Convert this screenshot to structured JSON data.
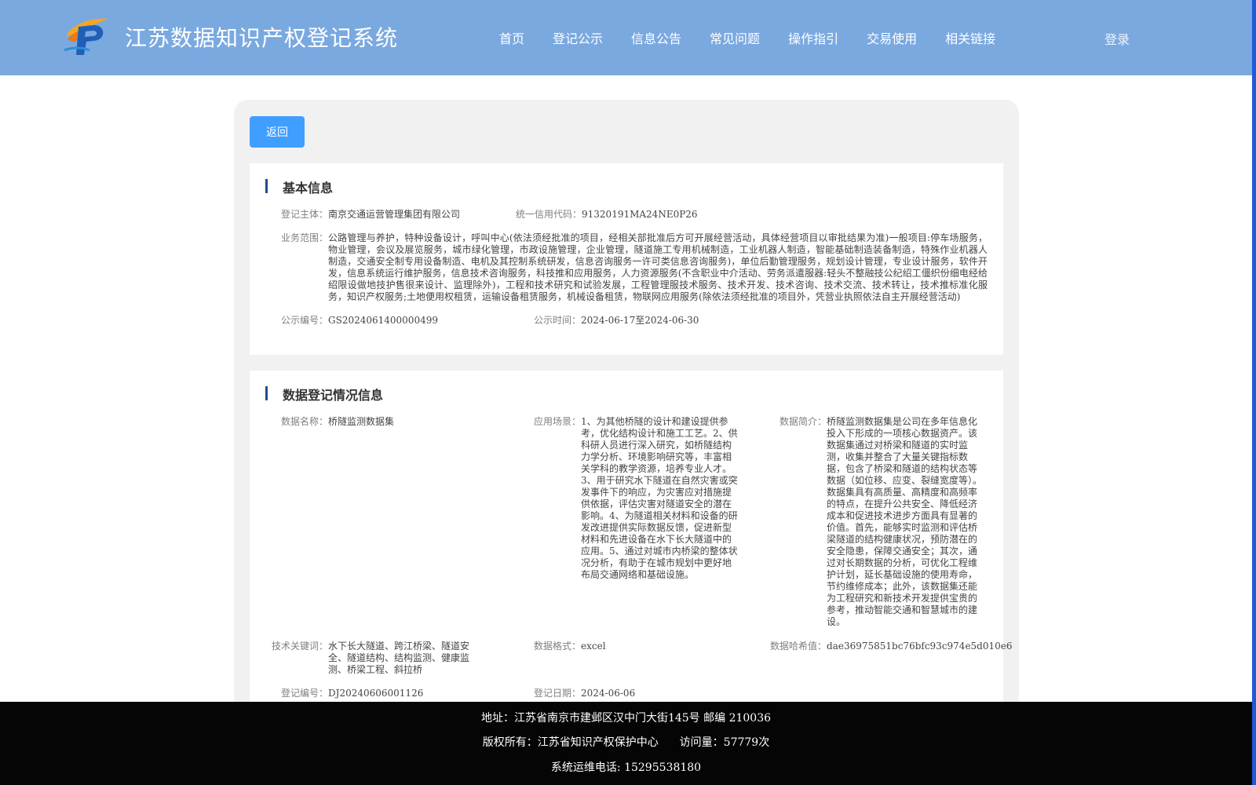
{
  "header": {
    "title": "江苏数据知识产权登记系统",
    "logo_icon": "ip-logo-icon",
    "nav": [
      "首页",
      "登记公示",
      "信息公告",
      "常见问题",
      "操作指引",
      "交易使用",
      "相关链接"
    ],
    "login": "登录"
  },
  "actions": {
    "back_label": "返回"
  },
  "basic": {
    "title": "基本信息",
    "subject_label": "登记主体：",
    "subject": "南京交通运营管理集团有限公司",
    "credit_label": "统一信用代码：",
    "credit": "91320191MA24NE0P26",
    "scope_label": "业务范围：",
    "scope": "公路管理与养护，特种设备设计，呼叫中心(依法须经批准的项目，经相关部批准后方可开展经营活动，具体经营项目以审批结果为准)一般项目:停车场服务，物业管理，会议及展览服务，城市绿化管理，市政设施管理，企业管理，隧道施工专用机械制造，工业机器人制造，智能基础制造装备制造，特殊作业机器人制造，交通安全制专用设备制造、电机及其控制系统研发，信息咨询服务一许可类信息咨询服务)，单位后勤管理服务，规划设计管理，专业设计服务，软件开发，信息系统运行维护服务，信息技术咨询服务，科技推和应用服务，人力资源服务(不含职业中介活动、劳务派遣服器:轻头不整融技公纪绍工僵织份细电经给绍限设做地技护售很来设计、监理除外)，工程和技术研究和试验发展，工程管理服技术服务、技术开发、技术咨询、技术交流、技术转让，技术推标准化服务，知识产权服务;土地便用权租赁，运输设备租赁服务，机械设备租赁，物联网应用服务(除依法须经批准的项目外，凭营业执照依法自主开展经营活动)",
    "notice_no_label": "公示编号：",
    "notice_no": "GS2024061400000499",
    "notice_time_label": "公示时间：",
    "notice_time_start": "2024-06-17",
    "notice_time_sep": "至",
    "notice_time_end": "2024-06-30"
  },
  "registration": {
    "title": "数据登记情况信息",
    "name_label": "数据名称：",
    "name": "桥隧监测数据集",
    "scenario_label": "应用场景：",
    "scenario": "1、为其他桥隧的设计和建设提供参考，优化结构设计和施工工艺。2、供科研人员进行深入研究，如桥隧结构力学分析、环境影响研究等，丰富相关学科的教学资源，培养专业人才。3、用于研究水下隧道在自然灾害或突发事件下的响应，为灾害应对措施提供依据，评估灾害对隧道安全的潜在影响。4、为隧道相关材料和设备的研发改进提供实际数据反馈，促进新型材料和先进设备在水下长大隧道中的应用。5、通过对城市内桥梁的整体状况分析，有助于在城市规划中更好地布局交通网络和基础设施。",
    "intro_label": "数据简介：",
    "intro": "桥隧监测数据集是公司在多年信息化投入下形成的一项核心数据资产。该数据集通过对桥梁和隧道的实时监测，收集并整合了大量关键指标数据，包含了桥梁和隧道的结构状态等数据（如位移、应变、裂缝宽度等）。数据集具有高质量、高精度和高频率的特点，在提升公共安全、降低经济成本和促进技术进步方面具有显著的价值。首先，能够实时监测和评估桥梁隧道的结构健康状况，预防潜在的安全隐患，保障交通安全；其次，通过对长期数据的分析，可优化工程维护计划，延长基础设施的使用寿命，节约维修成本；此外，该数据集还能为工程研究和新技术开发提供宝贵的参考，推动智能交通和智慧城市的建设。",
    "keywords_label": "技术关键词：",
    "keywords": "水下长大隧道、跨江桥梁、隧道安全、隧道结构、结构监测、健康监测、桥梁工程、斜拉桥",
    "format_label": "数据格式：",
    "format": "excel",
    "hash_label": "数据哈希值：",
    "hash": "dae36975851bc76bfc93c974e5d010e6",
    "reg_no_label": "登记编号：",
    "reg_no": "DJ20240606001126",
    "reg_date_label": "登记日期：",
    "reg_date": "2024-06-06"
  },
  "footer": {
    "address": "地址：江苏省南京市建邺区汉中门大街145号 邮编 210036",
    "copyright": "版权所有：江苏省知识产权保护中心",
    "visits_label": "访问量：",
    "visits": "57779次",
    "phone": "系统运维电话: 15295538180"
  },
  "colors": {
    "header_bg": "#7aa9e0",
    "accent": "#409eff",
    "footer_bg": "#050505",
    "section_bar": "#1f4e8c"
  }
}
